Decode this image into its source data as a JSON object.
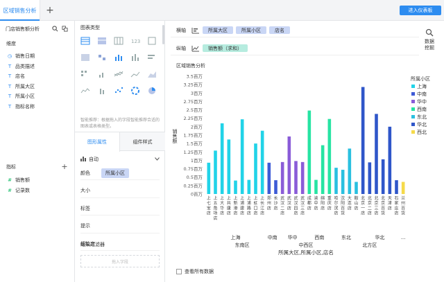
{
  "tab": {
    "title": "区域销售分析",
    "add": "+"
  },
  "enter_button": "进入仪表板",
  "left": {
    "dataset": "门店销售额分析",
    "dimension_title": "维度",
    "dimensions": [
      {
        "type": "◷",
        "label": "销售日期"
      },
      {
        "type": "T",
        "label": "品类描述"
      },
      {
        "type": "T",
        "label": "店名"
      },
      {
        "type": "T",
        "label": "所属大区"
      },
      {
        "type": "T",
        "label": "所属小区"
      },
      {
        "type": "T",
        "label": "指标名称"
      }
    ],
    "metric_title": "指标",
    "metric_add": "+",
    "metrics": [
      {
        "type": "#",
        "label": "销售额"
      },
      {
        "type": "#",
        "label": "记录数"
      }
    ]
  },
  "mid": {
    "title": "图表类型",
    "hint": "智能推荐：根据拖入的字段智能推荐合适的图表或表格类型。",
    "tabs": [
      "图形属性",
      "组件样式"
    ],
    "auto": "自动",
    "props": [
      {
        "label": "颜色",
        "chip": "所属小区"
      },
      {
        "label": "大小",
        "chip": ""
      },
      {
        "label": "标签",
        "chip": ""
      },
      {
        "label": "提示",
        "chip": ""
      },
      {
        "label": "细粒度",
        "chip": ""
      }
    ],
    "filter_title": "结果过滤器",
    "filter_placeholder": "拖入字段"
  },
  "axes": {
    "x_label": "横轴",
    "x_pills": [
      "所属大区",
      "所属小区",
      "店名"
    ],
    "y_label": "纵轴",
    "y_pills": [
      "销售额（求和）"
    ]
  },
  "zoom_label": "数据挖掘",
  "show_all": "查看所有数据",
  "colors": {
    "accent": "#2d8cf0"
  },
  "chart_data": {
    "type": "bar",
    "title": "区域销售分析",
    "ylabel": "销售额",
    "xlabel": "所属大区,所属小区,店名",
    "ylim": [
      0,
      3500000
    ],
    "yticks": [
      "0百万",
      "0.25百万",
      "0.5百万",
      "0.75百万",
      "1百万",
      "1.25百万",
      "1.5百万",
      "1.75百万",
      "2百万",
      "2.25百万",
      "2.5百万",
      "2.75百万",
      "3百万",
      "3.25百万",
      "3.5百万"
    ],
    "legend_title": "所属小区",
    "legend": [
      {
        "name": "上海",
        "color": "#21d3e8"
      },
      {
        "name": "中南",
        "color": "#3e5bd6"
      },
      {
        "name": "华中",
        "color": "#8a5cd8"
      },
      {
        "name": "西南",
        "color": "#27e4a3"
      },
      {
        "name": "东北",
        "color": "#2ac0e0"
      },
      {
        "name": "华北",
        "color": "#2f56c9"
      },
      {
        "name": "西北",
        "color": "#f5da4a"
      }
    ],
    "categories": [
      "上七宝店",
      "上五角场店",
      "上大华店",
      "上共康店",
      "上新港店",
      "上浦建店",
      "上浦路店",
      "上虹口店",
      "上长江店",
      "郑州店",
      "长沙店",
      "武汉二店",
      "武汉店",
      "武汉四店",
      "武汉三店",
      "成都店",
      "渝中店",
      "绵阳店",
      "重庆店",
      "哈尔滨店",
      "沈阳百货",
      "大连店",
      "鞍山店",
      "北京一店",
      "北京二店",
      "北京三店",
      "北京百货",
      "天津店",
      "石家庄店",
      "兰州百货"
    ],
    "subregion_of_bar": [
      "上海",
      "上海",
      "上海",
      "上海",
      "上海",
      "上海",
      "上海",
      "上海",
      "上海",
      "中南",
      "中南",
      "华中",
      "华中",
      "华中",
      "华中",
      "西南",
      "西南",
      "西南",
      "西南",
      "东北",
      "东北",
      "东北",
      "东北",
      "华北",
      "华北",
      "华北",
      "华北",
      "华北",
      "华北",
      "西北"
    ],
    "values": [
      930000,
      1290000,
      2100000,
      1620000,
      400000,
      2220000,
      420000,
      1500000,
      1880000,
      930000,
      410000,
      950000,
      1710000,
      980000,
      950000,
      2480000,
      420000,
      1450000,
      2230000,
      780000,
      720000,
      1350000,
      360000,
      3180000,
      940000,
      2380000,
      1030000,
      2000000,
      410000,
      360000
    ],
    "groups": [
      {
        "region": "东南区",
        "subregions": [
          "上海",
          "中南"
        ]
      },
      {
        "region": "中西区",
        "subregions": [
          "华中",
          "西南"
        ]
      },
      {
        "region": "北方区",
        "subregions": [
          "东北",
          "华北",
          "..."
        ]
      }
    ]
  }
}
